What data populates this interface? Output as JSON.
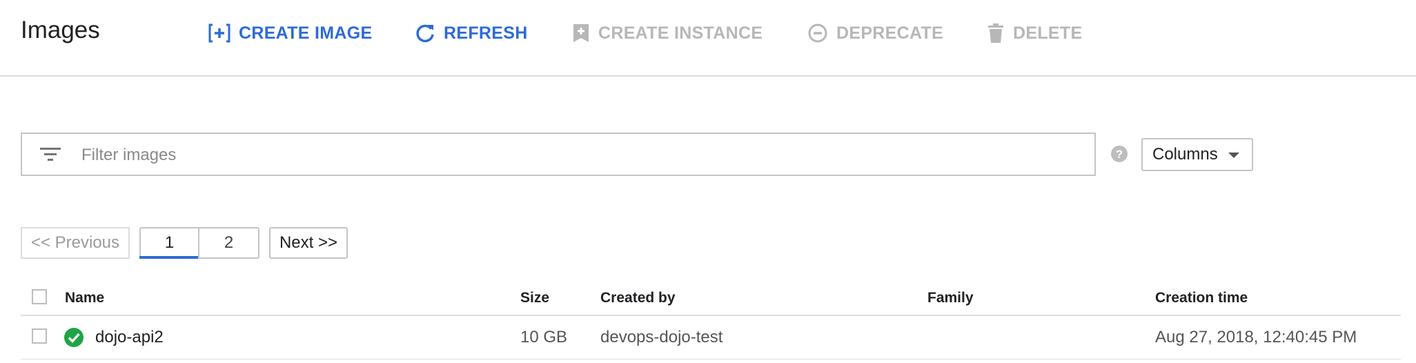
{
  "header": {
    "title": "Images",
    "actions": [
      {
        "label": "CREATE IMAGE",
        "icon": "create-image-icon",
        "enabled": true
      },
      {
        "label": "REFRESH",
        "icon": "refresh-icon",
        "enabled": true
      },
      {
        "label": "CREATE INSTANCE",
        "icon": "create-instance-icon",
        "enabled": false
      },
      {
        "label": "DEPRECATE",
        "icon": "deprecate-icon",
        "enabled": false
      },
      {
        "label": "DELETE",
        "icon": "trash-icon",
        "enabled": false
      }
    ]
  },
  "filter": {
    "placeholder": "Filter images",
    "value": ""
  },
  "columns_button": {
    "label": "Columns"
  },
  "pagination": {
    "previous": "<< Previous",
    "pages": [
      "1",
      "2"
    ],
    "current": "1",
    "next": "Next >>"
  },
  "table": {
    "headers": {
      "name": "Name",
      "size": "Size",
      "created_by": "Created by",
      "family": "Family",
      "creation_time": "Creation time"
    },
    "rows": [
      {
        "status": "ready",
        "name": "dojo-api2",
        "size": "10 GB",
        "created_by": "devops-dojo-test",
        "family": "",
        "creation_time": "Aug 27, 2018, 12:40:45 PM"
      }
    ]
  },
  "colors": {
    "accent": "#2d6bd6",
    "disabled": "#b7b7b7",
    "status_ok": "#1ea446"
  }
}
